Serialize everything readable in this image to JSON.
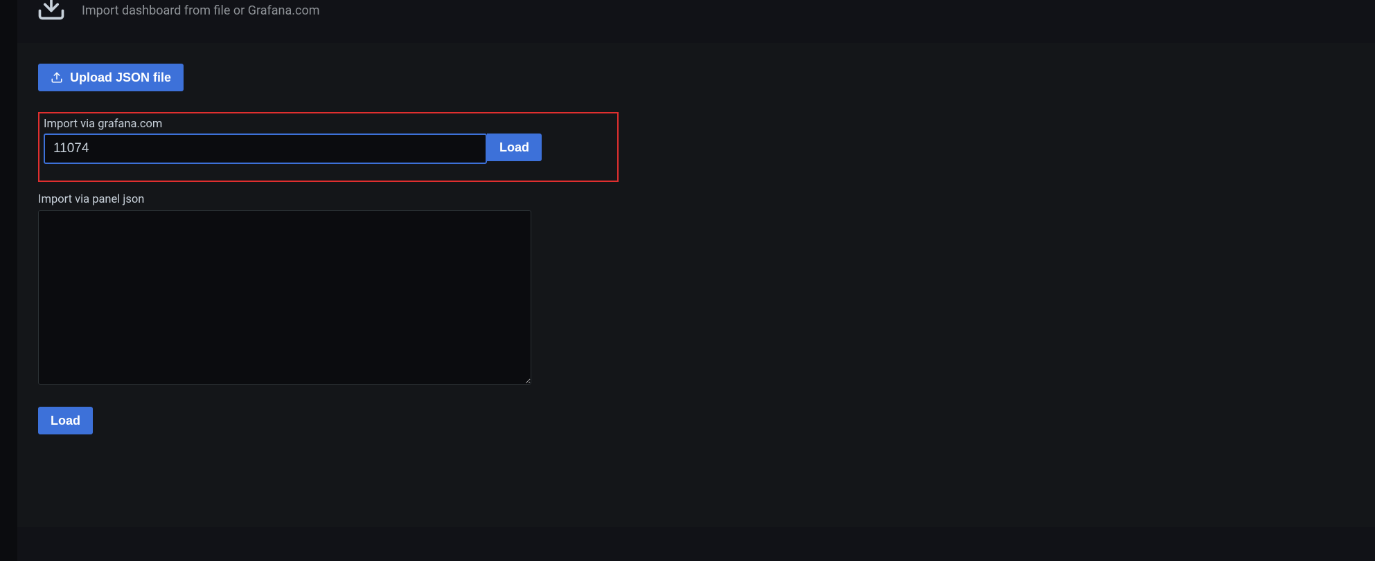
{
  "header": {
    "subtitle": "Import dashboard from file or Grafana.com"
  },
  "upload": {
    "button_label": "Upload JSON file"
  },
  "grafana_import": {
    "label": "Import via grafana.com",
    "value": "11074",
    "load_label": "Load"
  },
  "panel_json": {
    "label": "Import via panel json",
    "value": ""
  },
  "bottom": {
    "load_label": "Load"
  }
}
